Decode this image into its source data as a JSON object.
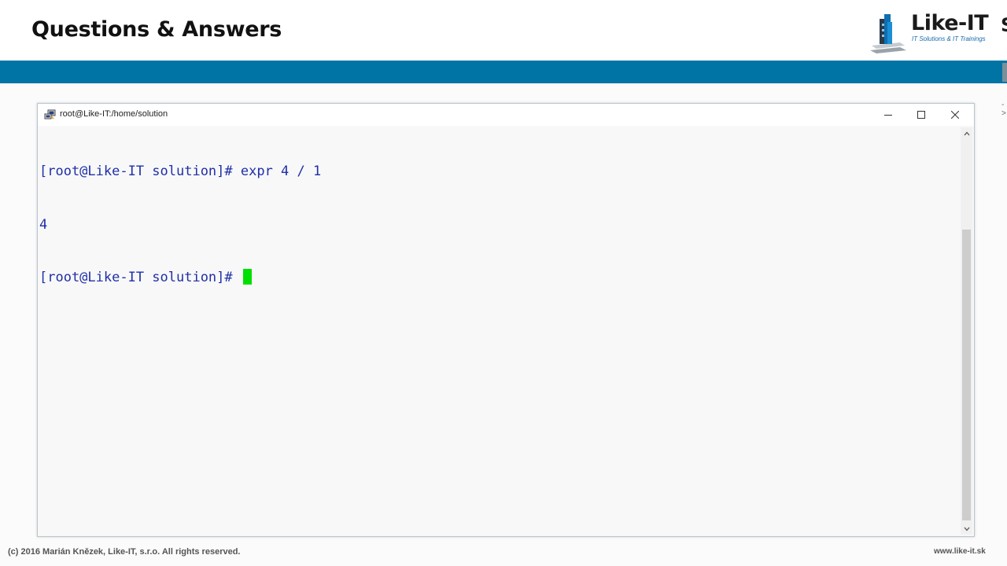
{
  "slide": {
    "title": "Questions & Answers",
    "logo_name": "Like-IT",
    "logo_tagline": "IT Solutions & IT Trainings",
    "band_color": "#0074a4",
    "footer_left": "(c) 2016 Marián Knězek, Like-IT, s.r.o. All rights reserved.",
    "footer_right": "www.like-it.sk"
  },
  "window": {
    "title": "root@Like-IT:/home/solution",
    "icon": "putty-icon",
    "controls": [
      "minimize-icon",
      "maximize-icon",
      "close-icon"
    ]
  },
  "terminal": {
    "lines": [
      "[root@Like-IT solution]# expr 4 / 1",
      "4",
      "[root@Like-IT solution]# "
    ],
    "text_color": "#1f2fa8",
    "cursor_color": "#00e000"
  }
}
